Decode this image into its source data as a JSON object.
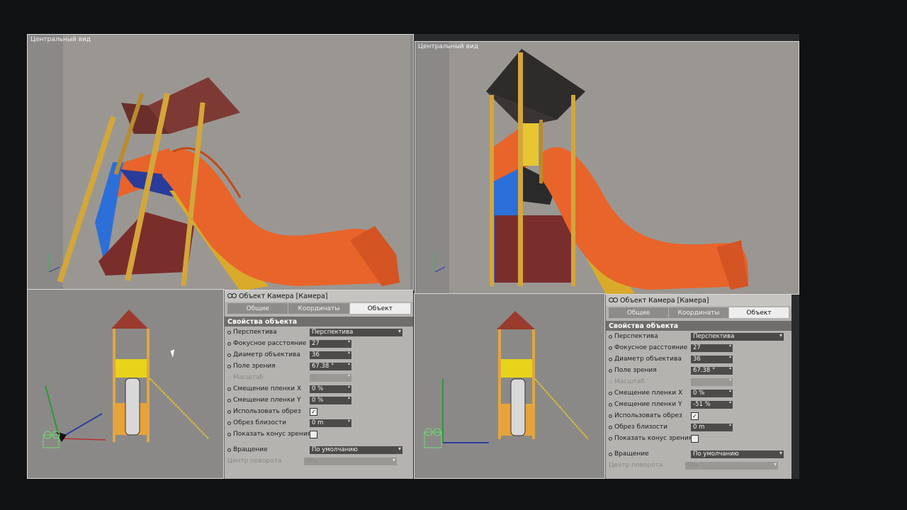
{
  "viewports": [
    {
      "title": "Центральный вид"
    },
    {
      "title": "Центральный вид"
    }
  ],
  "panel": {
    "header": "Объект Камера [Камера]",
    "tabs": [
      "Общие",
      "Координаты",
      "Объект"
    ],
    "section": "Свойства объекта",
    "projection_label": "Перспектива",
    "projection_value": "Перспектива",
    "focal_label": "Фокусное расстояние",
    "focal_value": "27",
    "aperture_label": "Диаметр объектива",
    "aperture_value": "36",
    "fov_label": "Поле зрения",
    "fov_value": "67.38 °",
    "scale_label": "Масштаб",
    "scale_value": "1",
    "shiftx_label": "Смещение пленки X",
    "shiftx_value": "0 %",
    "shifty_label": "Смещение пленки Y",
    "shifty_value_left": "0 %",
    "shifty_value_right": "-51 %",
    "clip_label": "Использовать обрез",
    "near_label": "Обрез близости",
    "near_value": "0 m",
    "cone_label": "Показать конус зрения",
    "rot_label": "Вращение",
    "rot_value": "По умолчанию",
    "pivot_label": "Центр поворота",
    "pivot_value": "Ось"
  },
  "colors": {
    "slide": "#e8642a",
    "roof": "#7d3a34",
    "post": "#d4a63a",
    "blue": "#2c6fd8",
    "yellow": "#e7c631"
  }
}
